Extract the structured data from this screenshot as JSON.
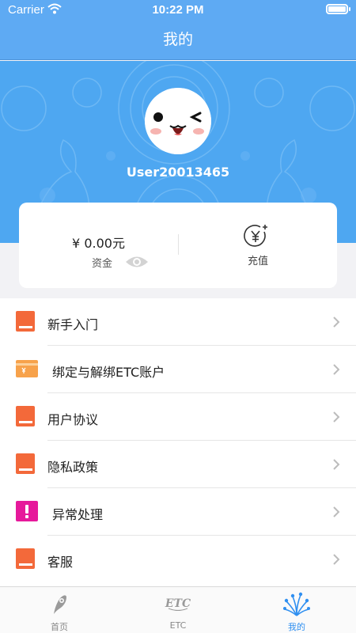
{
  "status_bar": {
    "carrier": "Carrier",
    "time": "10:22 PM"
  },
  "nav": {
    "title": "我的"
  },
  "profile": {
    "username": "User20013465"
  },
  "wallet": {
    "balance": "¥ 0.00元",
    "fund_label": "资金",
    "recharge_label": "充值"
  },
  "menu": {
    "items": [
      {
        "label": "新手入门",
        "icon": "book-icon"
      },
      {
        "label": "绑定与解绑ETC账户",
        "icon": "card-icon"
      },
      {
        "label": "用户协议",
        "icon": "book-icon"
      },
      {
        "label": "隐私政策",
        "icon": "book-icon"
      },
      {
        "label": "异常处理",
        "icon": "alert-icon"
      },
      {
        "label": "客服",
        "icon": "book-icon"
      }
    ]
  },
  "tab_bar": {
    "tabs": [
      {
        "label": "首页",
        "icon": "feather-icon",
        "active": false
      },
      {
        "label": "ETC",
        "icon": "etc-icon",
        "active": false
      },
      {
        "label": "我的",
        "icon": "fountain-icon",
        "active": true
      }
    ]
  },
  "colors": {
    "header_blue": "#5eaaf3",
    "hero_blue": "#4ea7f1",
    "book_orange": "#f3693a",
    "card_orange": "#f7a24b",
    "alert_magenta": "#e6199b",
    "tab_active": "#2f8ff0"
  }
}
